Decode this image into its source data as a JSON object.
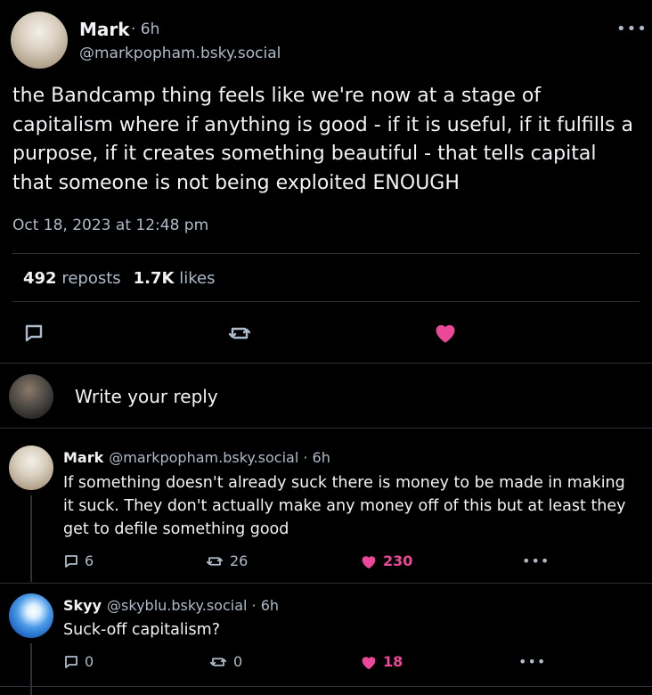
{
  "post": {
    "author_name": "Mark",
    "time": "· 6h",
    "handle": "@markpopham.bsky.social",
    "more": "•••",
    "text": "the Bandcamp thing feels like we're now at a stage of capitalism where if anything is good - if it is useful, if it fulfills a purpose, if it creates something beautiful - that tells capital that someone is not being exploited ENOUGH",
    "date": "Oct 18, 2023 at 12:48 pm",
    "reposts_count": "492",
    "reposts_label": "reposts",
    "likes_count": "1.7K",
    "likes_label": "likes"
  },
  "reply_prompt": "Write your reply",
  "replies": [
    {
      "name": "Mark",
      "meta": "@markpopham.bsky.social · 6h",
      "text": "If something doesn't already suck there is money to be made in making it suck. They don't actually make any money off of this but at least they get to defile something good",
      "replies": "6",
      "reposts": "26",
      "likes": "230",
      "more": "•••"
    },
    {
      "name": "Skyy",
      "meta": "@skyblu.bsky.social · 6h",
      "text": "Suck-off capitalism?",
      "replies": "0",
      "reposts": "0",
      "likes": "18",
      "more": "•••"
    }
  ],
  "colors": {
    "background": "#000000",
    "text": "#f1f3f5",
    "muted": "#aebbc9",
    "like": "#ec4899",
    "divider": "#2e3238"
  },
  "icons": [
    "comment-icon",
    "repost-icon",
    "heart-icon",
    "more-icon"
  ]
}
